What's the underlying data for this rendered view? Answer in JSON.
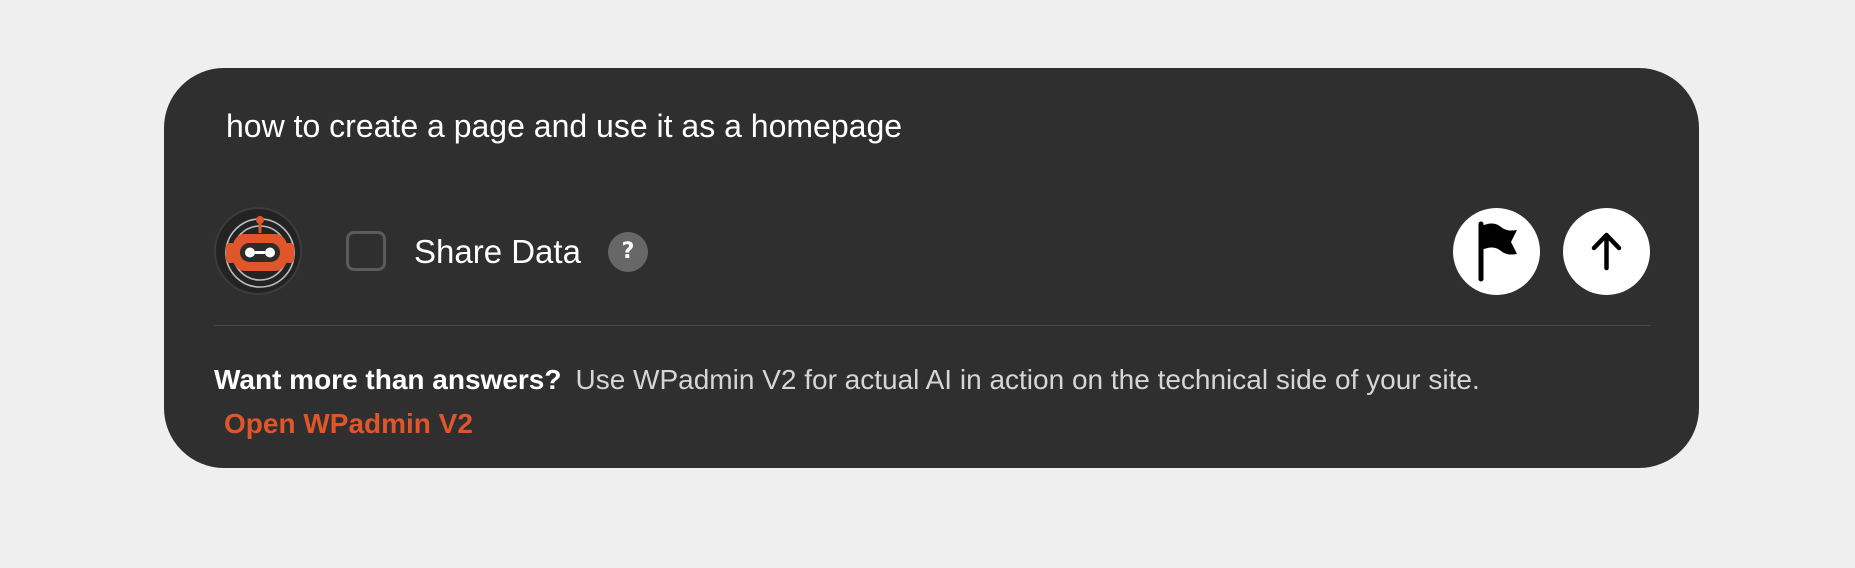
{
  "chat": {
    "query": "how to create a page and use it as a homepage"
  },
  "controls": {
    "avatar_icon": "robot-icon",
    "share_label": "Share Data",
    "share_checked": false,
    "help_glyph": "?",
    "flag_icon": "flag-icon",
    "send_icon": "arrow-up-icon"
  },
  "footer": {
    "lead": "Want more than answers?",
    "description": "Use WPadmin V2 for actual AI in action on the technical side of your site.",
    "link_label": "Open WPadmin V2"
  },
  "colors": {
    "page_background": "#efefef",
    "panel_background": "#2f2f2f",
    "accent": "#e0552a",
    "text_primary": "#ffffff",
    "text_secondary": "#d6d6d6"
  }
}
